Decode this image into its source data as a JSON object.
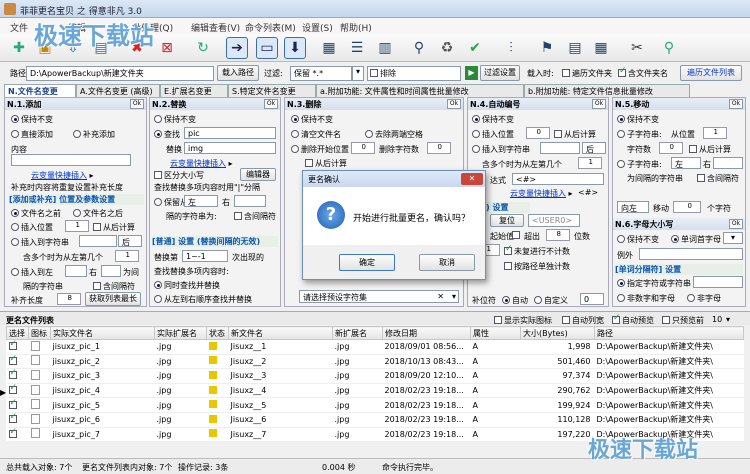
{
  "title": "菲菲更名宝贝 之 得意非凡 3.0",
  "menu": [
    "文件",
    "编辑",
    "批处理(Q)",
    "编辑查看(V)",
    "命令列表(M)",
    "设置(S)",
    "帮助(H)"
  ],
  "watermark": "极速下载站",
  "path": {
    "label": "路径",
    "value": "D:\\ApowerBackup\\新建文件夹",
    "load_btn": "载入路径"
  },
  "filter": {
    "label": "过滤:",
    "value": "保留 *.*",
    "exclude_label": "排除",
    "filter_btn": "过滤设置"
  },
  "load_opts": {
    "label": "载入时:",
    "traverse": "遍历文件夹",
    "include_names": "含文件夹名",
    "traverse_list": "遍历文件列表"
  },
  "tabs": [
    "N.文件名变更",
    "A.文件名变更 (高级)",
    "E.扩展名变更",
    "S.特定文件名变更",
    "a.附加功能: 文件属性和时间属性批量修改",
    "b.附加功能: 特定文件信息批量修改"
  ],
  "p1": {
    "title": "N.1.添加",
    "ok": "Ok",
    "keep": "保持不变",
    "direct": "直接添加",
    "pad": "补充添加",
    "content": "内容",
    "var_insert": "云变量快捷插入",
    "hint": "补充时内容将重复设置补充长度",
    "sub": "[添加或补充] 位置及参数设置",
    "before": "文件名之前",
    "after": "文件名之后",
    "insert_pos": "插入位置",
    "insert_pos_val": "1",
    "from_end": "从后计算",
    "insert_char": "插入到字符串",
    "after_dd": "后",
    "multi_left": "含多个时为从左第几个",
    "multi_val": "1",
    "insert_at": "插入到左",
    "right": "右",
    "as": "为间",
    "sep": "隔的字符串",
    "contain_sep": "含间隔符",
    "pad_len": "补齐长度",
    "pad_val": "8",
    "get_len": "获取列表最长"
  },
  "p2": {
    "title": "N.2.替换",
    "ok": "Ok",
    "keep": "保持不变",
    "find": "查找",
    "find_val": "pic",
    "replace": "替换",
    "replace_val": "img",
    "var_insert": "云变量快捷插入",
    "case": "区分大小写",
    "editor": "编辑器",
    "multi_hint": "查找替换多项内容时用\"|\"分隔",
    "keep_between": "保留从",
    "left": "左",
    "right": "右",
    "sep": "隔的字符串为:",
    "contain_sep": "含间隔符",
    "sub": "[普通] 设置 (替换间隔的无效)",
    "replace_nth": "替换第",
    "nth_val": "1~-1",
    "occur": "次出现的",
    "multi": "查找替换多项内容时:",
    "simul": "同时查找并替换",
    "seq": "从左到右顺序查找并替换"
  },
  "p3": {
    "title": "N.3.删除",
    "ok": "Ok",
    "keep": "保持不变",
    "clear": "清空文件名",
    "remove_space": "去除两端空格",
    "del_pos": "删除开始位置",
    "del_pos_val": "0",
    "del_count": "删除字符数",
    "del_count_val": "0",
    "from_end": "从后计算",
    "choose": "请选择预设字符集"
  },
  "p4": {
    "title": "N.4.自动编号",
    "ok": "Ok",
    "keep": "保持不变",
    "insert_pos": "插入位置",
    "insert_pos_val": "0",
    "from_end": "从后计算",
    "insert_char": "插入到字符串",
    "after_dd": "后",
    "multi_left": "含多个时为从左第几个",
    "multi_val": "1",
    "expr": "达式",
    "expr_val": "<#>",
    "var_insert": "云变量快捷插入",
    "sub": "编号) 设置",
    "start": "起始值",
    "start_val": "1",
    "digits": "位数",
    "digits_val": "8",
    "skip": "未复进行不计数",
    "by_dir": "按路径单独计数",
    "pad": "补位符",
    "pad_val": "0",
    "auto": "自动",
    "custom": "自定义",
    "custom_val": "0",
    "reset": "复位",
    "user": "<USER0>"
  },
  "p5": {
    "title": "N.5.移动",
    "ok": "Ok",
    "keep": "保持不变",
    "substr": "子字符串:",
    "from_pos": "从位置",
    "from_pos_val": "1",
    "char_count": "字符数",
    "char_count_val": "0",
    "from_end": "从后计算",
    "substr2": "子字符串:",
    "left": "左",
    "right": "右",
    "sep": "为间隔的字符串",
    "contain_sep": "含间隔符",
    "dir": "向左",
    "move": "移动",
    "move_val": "0",
    "chars": "个字符"
  },
  "p6": {
    "title": "N.6.字母大小写",
    "ok": "Ok",
    "keep": "保持不变",
    "first_upper": "单词首字母",
    "example": "例外",
    "sub": "[单词分隔符] 设置",
    "specify": "指定字符或字符串",
    "non_digit": "非数字和字母",
    "non_letter": "非字母"
  },
  "dialog": {
    "title": "更名确认",
    "message": "开始进行批量更名，确认吗？",
    "confirm": "确定",
    "cancel": "取消"
  },
  "list": {
    "title": "更名文件列表",
    "show_icon": "显示实际图标",
    "auto_width": "自动列宽",
    "auto_preview": "自动预览",
    "preview_only": "只预览前",
    "preview_n": "10",
    "columns": [
      "选择",
      "图标",
      "实际文件名",
      "实际扩展名",
      "状态",
      "新文件名",
      "新扩展名",
      "修改日期",
      "属性",
      "大小(Bytes)",
      "路径"
    ],
    "rows": [
      [
        "jisuxz_pic_1",
        ".jpg",
        "Jisuxz__1",
        ".jpg",
        "2018/09/01 08:56...",
        "A",
        "1,998",
        "D:\\ApowerBackup\\新建文件夹\\"
      ],
      [
        "jisuxz_pic_2",
        ".jpg",
        "Jisuxz__2",
        ".jpg",
        "2018/10/13 08:43...",
        "A",
        "501,460",
        "D:\\ApowerBackup\\新建文件夹\\"
      ],
      [
        "jisuxz_pic_3",
        ".jpg",
        "Jisuxz__3",
        ".jpg",
        "2018/09/20 12:10...",
        "A",
        "97,374",
        "D:\\ApowerBackup\\新建文件夹\\"
      ],
      [
        "jisuxz_pic_4",
        ".jpg",
        "Jisuxz__4",
        ".jpg",
        "2018/02/23 19:18...",
        "A",
        "290,762",
        "D:\\ApowerBackup\\新建文件夹\\"
      ],
      [
        "jisuxz_pic_5",
        ".jpg",
        "Jisuxz__5",
        ".jpg",
        "2018/02/23 19:18...",
        "A",
        "199,924",
        "D:\\ApowerBackup\\新建文件夹\\"
      ],
      [
        "jisuxz_pic_6",
        ".jpg",
        "Jisuxz__6",
        ".jpg",
        "2018/02/23 19:18...",
        "A",
        "110,128",
        "D:\\ApowerBackup\\新建文件夹\\"
      ],
      [
        "jisuxz_pic_7",
        ".jpg",
        "Jisuxz__7",
        ".jpg",
        "2018/02/23 19:18...",
        "A",
        "197,220",
        "D:\\ApowerBackup\\新建文件夹\\"
      ]
    ]
  },
  "status": {
    "total": "总共载入对象: 7个",
    "list_objs": "更名文件列表内对象: 7个",
    "ops": "操作记录: 3条",
    "time": "0.004 秒",
    "msg": "命令执行完毕。"
  },
  "toolbar_icons": [
    "add-file",
    "add-folder",
    "load",
    "save",
    "delete",
    "delete-list",
    "refresh",
    "undo",
    "rename-all",
    "rename-sel",
    "grid",
    "list-view",
    "view",
    "search",
    "recycle",
    "check",
    "equalizer",
    "flag",
    "table",
    "layout",
    "tools",
    "pin"
  ]
}
